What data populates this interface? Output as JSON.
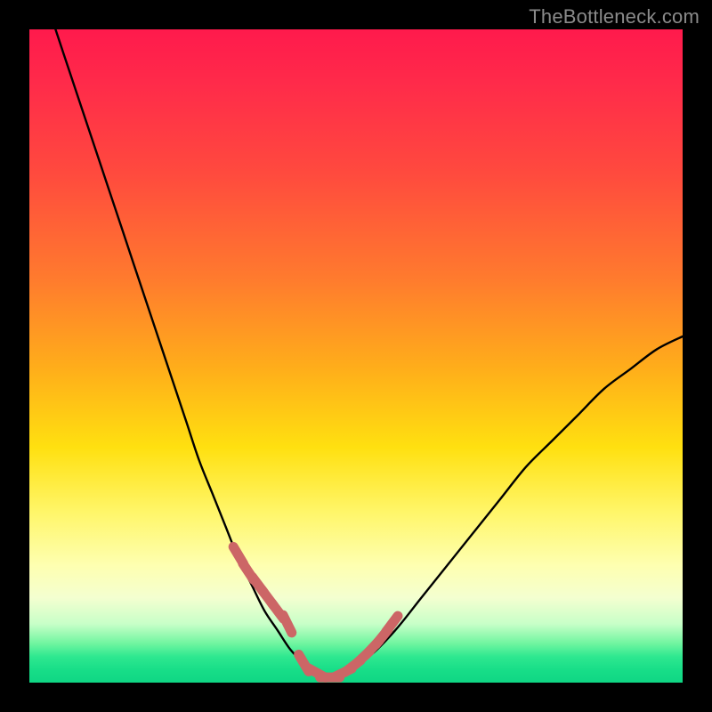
{
  "watermark": {
    "text": "TheBottleneck.com"
  },
  "colors": {
    "frame": "#000000",
    "curve_stroke": "#000000",
    "marker_stroke": "#cc6666",
    "gradient_top": "#ff1a4c",
    "gradient_mid": "#ffe010",
    "gradient_bottom": "#0fd684"
  },
  "chart_data": {
    "type": "line",
    "title": "",
    "xlabel": "",
    "ylabel": "",
    "xlim": [
      0,
      100
    ],
    "ylim": [
      0,
      100
    ],
    "grid": false,
    "legend": false,
    "series": [
      {
        "name": "bottleneck-curve",
        "x": [
          4,
          6,
          8,
          10,
          12,
          14,
          16,
          18,
          20,
          22,
          24,
          26,
          28,
          30,
          32,
          34,
          36,
          38,
          40,
          42,
          44,
          46,
          48,
          52,
          56,
          60,
          64,
          68,
          72,
          76,
          80,
          84,
          88,
          92,
          96,
          100
        ],
        "values": [
          100,
          94,
          88,
          82,
          76,
          70,
          64,
          58,
          52,
          46,
          40,
          34,
          29,
          24,
          19,
          15,
          11,
          8,
          5,
          3,
          1.5,
          0.8,
          1.5,
          4,
          8,
          13,
          18,
          23,
          28,
          33,
          37,
          41,
          45,
          48,
          51,
          53
        ]
      }
    ],
    "markers": [
      {
        "name": "threshold-markers",
        "x": [
          32,
          33.5,
          35,
          36.5,
          38,
          39.5,
          42,
          44,
          46,
          48,
          49.5,
          51,
          52.5,
          54,
          55.5
        ],
        "values": [
          19.5,
          17,
          15,
          13,
          11,
          9,
          3,
          1.5,
          0.8,
          1.5,
          2.5,
          3.8,
          5.3,
          7,
          9
        ]
      }
    ]
  }
}
